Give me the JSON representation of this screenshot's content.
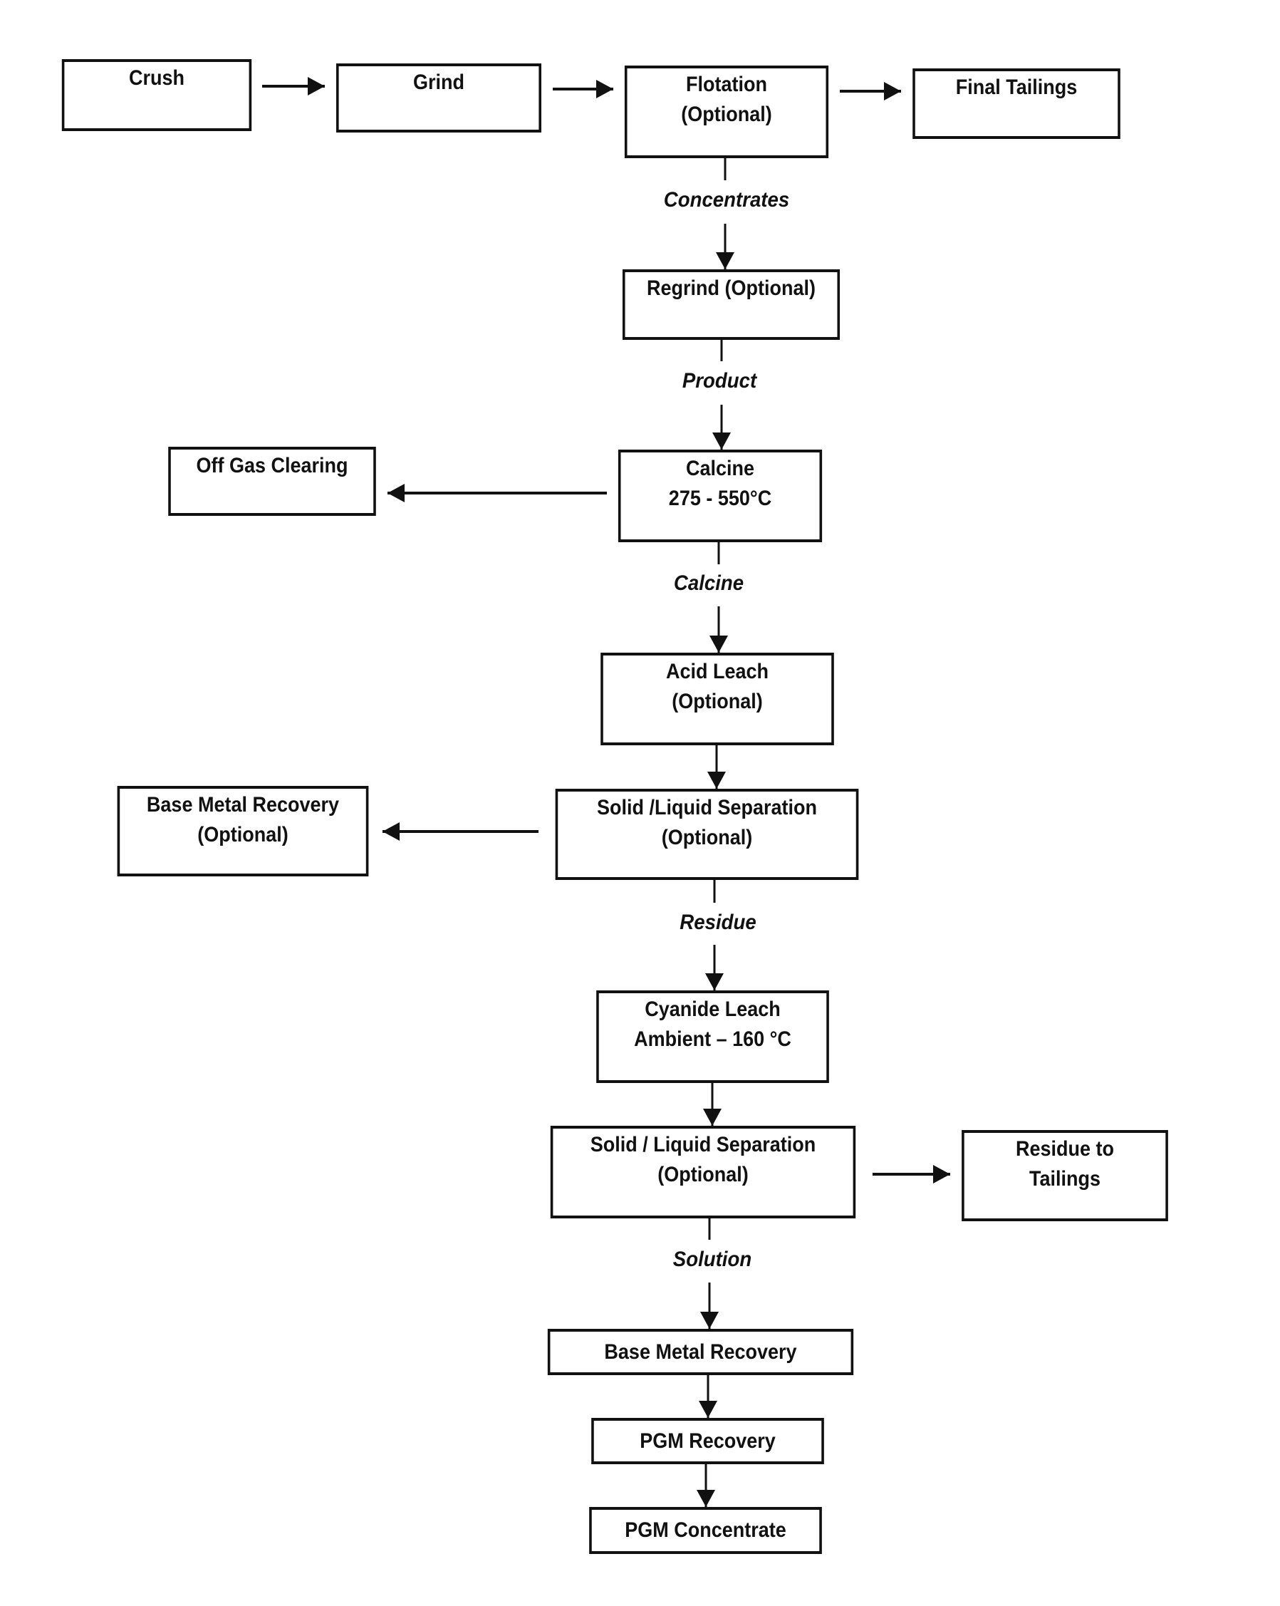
{
  "diagram": {
    "type": "process-flowchart",
    "nodes": {
      "crush": {
        "lines": [
          "Crush"
        ]
      },
      "grind": {
        "lines": [
          "Grind"
        ]
      },
      "flotation": {
        "lines": [
          "Flotation",
          "(Optional)"
        ]
      },
      "final_tailings": {
        "lines": [
          "Final Tailings"
        ]
      },
      "regrind": {
        "lines": [
          "Regrind (Optional)"
        ]
      },
      "calcine": {
        "lines": [
          "Calcine",
          "275 - 550°C"
        ]
      },
      "off_gas": {
        "lines": [
          "Off Gas Clearing"
        ]
      },
      "acid_leach": {
        "lines": [
          "Acid Leach",
          "(Optional)"
        ]
      },
      "sl_sep_1": {
        "lines": [
          "Solid /Liquid Separation",
          "(Optional)"
        ]
      },
      "base_metal_recovery_opt": {
        "lines": [
          "Base Metal Recovery",
          "(Optional)"
        ]
      },
      "cyanide_leach": {
        "lines": [
          "Cyanide Leach",
          "Ambient – 160 °C"
        ]
      },
      "sl_sep_2": {
        "lines": [
          "Solid / Liquid Separation",
          "(Optional)"
        ]
      },
      "residue_to_tailings": {
        "lines": [
          "Residue to",
          "Tailings"
        ]
      },
      "base_metal_recovery": {
        "lines": [
          "Base Metal Recovery"
        ]
      },
      "pgm_recovery": {
        "lines": [
          "PGM Recovery"
        ]
      },
      "pgm_concentrate": {
        "lines": [
          "PGM Concentrate"
        ]
      }
    },
    "edge_labels": {
      "concentrates": "Concentrates",
      "product": "Product",
      "calcine": "Calcine",
      "residue": "Residue",
      "solution": "Solution"
    },
    "edges": [
      {
        "from": "crush",
        "to": "grind"
      },
      {
        "from": "grind",
        "to": "flotation"
      },
      {
        "from": "flotation",
        "to": "final_tailings"
      },
      {
        "from": "flotation",
        "to": "regrind",
        "label": "Concentrates"
      },
      {
        "from": "regrind",
        "to": "calcine",
        "label": "Product"
      },
      {
        "from": "calcine",
        "to": "off_gas"
      },
      {
        "from": "calcine",
        "to": "acid_leach",
        "label": "Calcine"
      },
      {
        "from": "acid_leach",
        "to": "sl_sep_1"
      },
      {
        "from": "sl_sep_1",
        "to": "base_metal_recovery_opt"
      },
      {
        "from": "sl_sep_1",
        "to": "cyanide_leach",
        "label": "Residue"
      },
      {
        "from": "cyanide_leach",
        "to": "sl_sep_2"
      },
      {
        "from": "sl_sep_2",
        "to": "residue_to_tailings"
      },
      {
        "from": "sl_sep_2",
        "to": "base_metal_recovery",
        "label": "Solution"
      },
      {
        "from": "base_metal_recovery",
        "to": "pgm_recovery"
      },
      {
        "from": "pgm_recovery",
        "to": "pgm_concentrate"
      }
    ],
    "colors": {
      "ink": "#111111",
      "background": "#ffffff"
    }
  }
}
